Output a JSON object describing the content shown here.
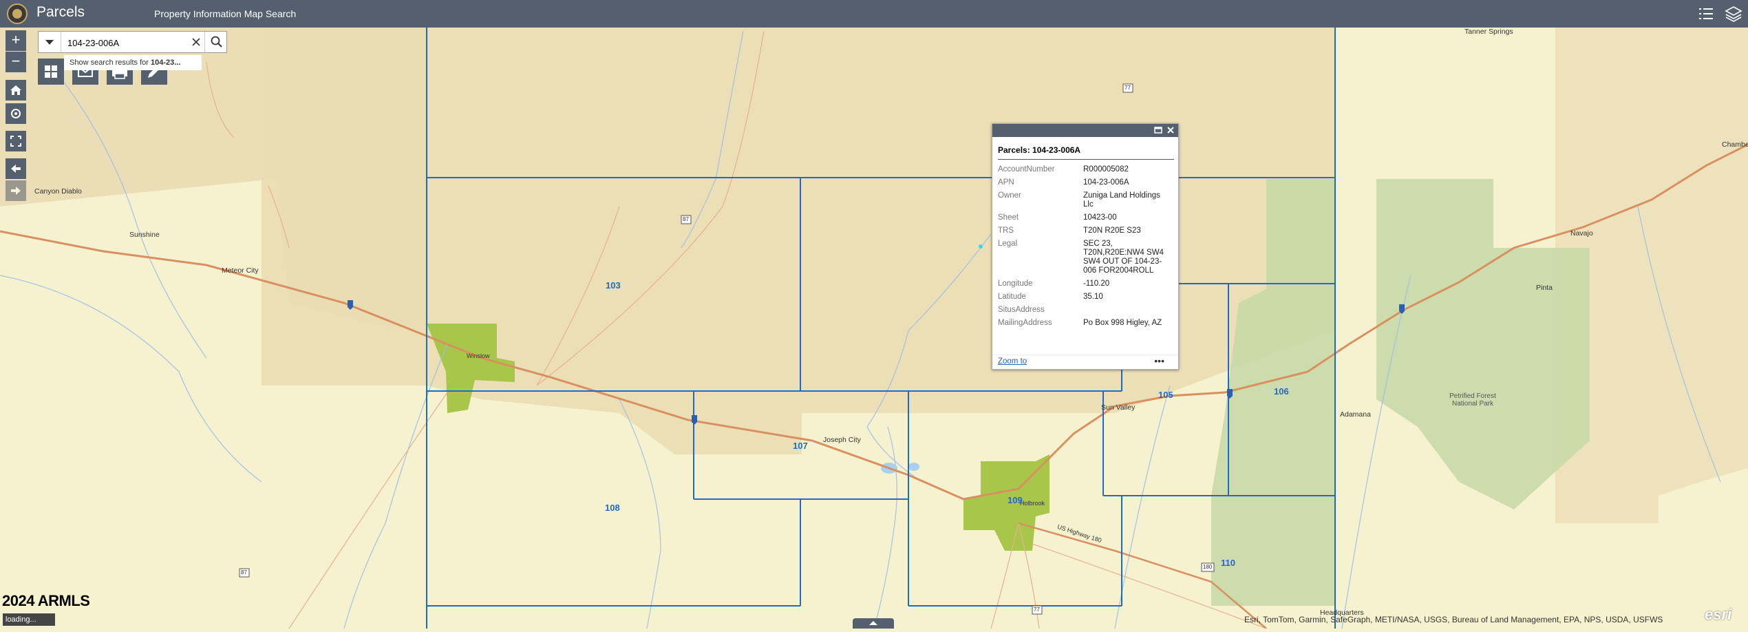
{
  "header": {
    "title": "Parcels",
    "subtitle": "Property Information Map Search"
  },
  "search": {
    "value": "104-23-006A",
    "suggestion_prefix": "Show search results for",
    "suggestion_term": "104-23..."
  },
  "popup": {
    "title": "Parcels: 104-23-006A",
    "fields": [
      {
        "key": "AccountNumber",
        "value": "R000005082"
      },
      {
        "key": "APN",
        "value": "104-23-006A"
      },
      {
        "key": "Owner",
        "value": "Zuniga Land Holdings Llc"
      },
      {
        "key": "Sheet",
        "value": "10423-00"
      },
      {
        "key": "TRS",
        "value": "T20N R20E S23"
      },
      {
        "key": "Legal",
        "value": "SEC 23, T20N,R20E:NW4 SW4 SW4 OUT OF 104-23-006 FOR2004ROLL"
      },
      {
        "key": "Longitude",
        "value": "-110.20"
      },
      {
        "key": "Latitude",
        "value": "35.10"
      },
      {
        "key": "SitusAddress",
        "value": ""
      },
      {
        "key": "MailingAddress",
        "value": "Po Box 998 Higley, AZ"
      }
    ],
    "zoom_to": "Zoom to",
    "more": "•••"
  },
  "map": {
    "places": [
      "Tanner Springs",
      "Canyon Diablo",
      "Sunshine",
      "Meteor City",
      "Winslow",
      "Joseph City",
      "Sun Valley",
      "Holbrook",
      "Navajo",
      "Pinta",
      "Adamana",
      "Petrified Forest National Park",
      "Chambers",
      "Headquarters"
    ],
    "parcels": [
      "103",
      "105",
      "106",
      "107",
      "108",
      "109",
      "110"
    ],
    "shields": [
      "77",
      "87",
      "40",
      "40",
      "40",
      "87",
      "77",
      "180"
    ],
    "highway_label": "US Highway 180"
  },
  "attribution": "Esri, TomTom, Garmin, SafeGraph, METI/NASA, USGS, Bureau of Land Management, EPA, NPS, USDA, USFWS",
  "watermark": "2024 ARMLS",
  "status": "loading...",
  "esri_logo": "esri",
  "colors": {
    "header": "#55606e",
    "parcel_line": "#1a6ad0",
    "reservation": "#eadcb2",
    "green_area": "#a7c64a",
    "park_area": "#c9d9a8",
    "highway": "#d99060"
  }
}
